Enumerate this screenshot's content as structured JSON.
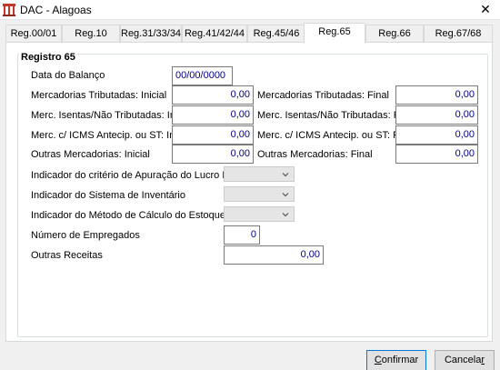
{
  "window": {
    "title": "DAC - Alagoas",
    "close_glyph": "✕"
  },
  "tabs": [
    {
      "label": "Reg.00/01"
    },
    {
      "label": "Reg.10"
    },
    {
      "label": "Reg.31/33/34"
    },
    {
      "label": "Reg.41/42/44"
    },
    {
      "label": "Reg.45/46"
    },
    {
      "label": "Reg.65"
    },
    {
      "label": "Reg.66"
    },
    {
      "label": "Reg.67/68"
    }
  ],
  "active_tab": "Reg.65",
  "group": {
    "title": "Registro 65"
  },
  "form": {
    "data_balanco": {
      "label": "Data do Balanço",
      "value": "00/00/0000"
    },
    "merc_trib_inicial": {
      "label": "Mercadorias Tributadas: Inicial",
      "value": "0,00"
    },
    "merc_trib_final": {
      "label": "Mercadorias Tributadas: Final",
      "value": "0,00"
    },
    "merc_isentas_inicial": {
      "label": "Merc. Isentas/Não Tributadas: Inicial",
      "value": "0,00"
    },
    "merc_isentas_final": {
      "label": "Merc. Isentas/Não Tributadas: Final",
      "value": "0,00"
    },
    "merc_icms_inicial": {
      "label": "Merc. c/ ICMS Antecip. ou ST: Inicial",
      "value": "0,00"
    },
    "merc_icms_final": {
      "label": "Merc. c/ ICMS Antecip. ou ST: Final",
      "value": "0,00"
    },
    "outras_inicial": {
      "label": "Outras Mercadorias: Inicial",
      "value": "0,00"
    },
    "outras_final": {
      "label": "Outras Mercadorias: Final",
      "value": "0,00"
    },
    "ind_criterio": {
      "label": "Indicador do critério de Apuração do Lucro Bruto",
      "value": ""
    },
    "ind_sistema": {
      "label": "Indicador do Sistema de Inventário",
      "value": ""
    },
    "ind_metodo": {
      "label": "Indicador do Método de Cálculo do Estoque",
      "value": ""
    },
    "num_empregados": {
      "label": "Número de Empregados",
      "value": "0"
    },
    "outras_receitas": {
      "label": "Outras Receitas",
      "value": "0,00"
    }
  },
  "buttons": {
    "confirm": {
      "mnemonic": "C",
      "rest": "onfirmar"
    },
    "cancel": {
      "pre": "Cancela",
      "mnemonic": "r"
    }
  },
  "colors": {
    "field_text": "#00007f",
    "app_icon": "#c0392b"
  },
  "icons": {
    "app": "app-logo-icon",
    "close": "close-icon",
    "combo_arrow": "chevron-down-icon"
  }
}
